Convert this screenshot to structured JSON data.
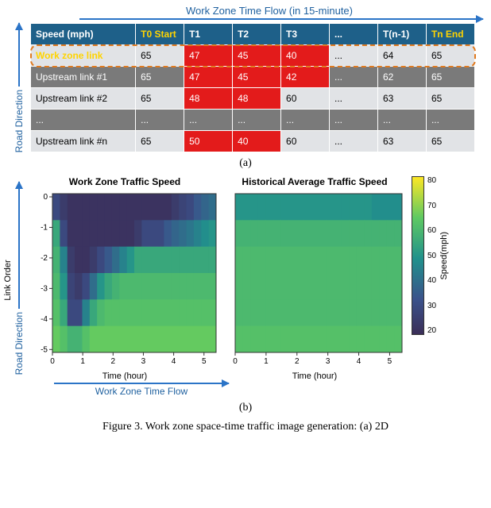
{
  "top_arrow_label": "Work Zone Time Flow (in 15-minute)",
  "road_direction_label": "Road Direction",
  "table": {
    "header": [
      "Speed (mph)",
      "T0 Start",
      "T1",
      "T2",
      "T3",
      "...",
      "T(n-1)",
      "Tn End"
    ],
    "rows": [
      {
        "label": "Work zone link",
        "cells": [
          "65",
          "47",
          "45",
          "40",
          "...",
          "64",
          "65"
        ],
        "red": [
          1,
          2,
          3
        ],
        "highlight_row": true
      },
      {
        "label": "Upstream link #1",
        "cells": [
          "65",
          "47",
          "45",
          "42",
          "...",
          "62",
          "65"
        ],
        "red": [
          1,
          2,
          3
        ]
      },
      {
        "label": "Upstream link #2",
        "cells": [
          "65",
          "48",
          "48",
          "60",
          "...",
          "63",
          "65"
        ],
        "red": [
          1,
          2
        ]
      },
      {
        "label": "...",
        "cells": [
          "...",
          "...",
          "...",
          "...",
          "...",
          "...",
          "..."
        ],
        "red": []
      },
      {
        "label": "Upstream link #n",
        "cells": [
          "65",
          "50",
          "40",
          "60",
          "...",
          "63",
          "65"
        ],
        "red": [
          1,
          2
        ]
      }
    ]
  },
  "sub_a": "(a)",
  "sub_b": "(b)",
  "heatmap": {
    "left_title": "Work Zone Traffic Speed",
    "right_title": "Historical Average Traffic Speed",
    "y_label": "Link Order",
    "x_label": "Time (hour)",
    "colorbar_label": "Speed(mph)",
    "colorbar_ticks": [
      "80",
      "70",
      "60",
      "50",
      "40",
      "30",
      "20"
    ],
    "x_ticks": [
      "0",
      "1",
      "2",
      "3",
      "4",
      "5"
    ],
    "y_ticks": [
      "0",
      "-1",
      "-2",
      "-3",
      "-4",
      "-5"
    ]
  },
  "bottom_arrow_label": "Work Zone Time Flow",
  "caption": "Figure 3. Work zone space-time traffic image generation: (a) 2D",
  "chart_data": [
    {
      "type": "heatmap",
      "title": "Work Zone Traffic Speed",
      "xlabel": "Time (hour)",
      "ylabel": "Link Order",
      "x_ticks": [
        0,
        1,
        2,
        3,
        4,
        5
      ],
      "y_ticks": [
        0,
        -1,
        -2,
        -3,
        -4,
        -5
      ],
      "colorbar_label": "Speed (mph)",
      "colorbar_range": [
        20,
        80
      ],
      "grid_rows": 6,
      "grid_cols": 22,
      "values_by_row": [
        [
          30,
          25,
          22,
          22,
          22,
          22,
          22,
          22,
          22,
          22,
          22,
          22,
          22,
          22,
          22,
          22,
          25,
          28,
          30,
          35,
          38,
          40
        ],
        [
          55,
          30,
          22,
          22,
          22,
          22,
          22,
          22,
          22,
          22,
          22,
          25,
          30,
          30,
          30,
          35,
          38,
          40,
          42,
          45,
          48,
          50
        ],
        [
          58,
          45,
          25,
          22,
          22,
          25,
          30,
          35,
          40,
          45,
          50,
          55,
          55,
          55,
          55,
          55,
          55,
          55,
          55,
          55,
          55,
          55
        ],
        [
          60,
          50,
          28,
          25,
          30,
          40,
          50,
          55,
          58,
          60,
          60,
          60,
          60,
          60,
          60,
          60,
          60,
          60,
          60,
          60,
          60,
          60
        ],
        [
          62,
          55,
          30,
          30,
          45,
          55,
          60,
          62,
          62,
          62,
          62,
          62,
          62,
          62,
          62,
          62,
          62,
          62,
          62,
          62,
          62,
          62
        ],
        [
          65,
          62,
          58,
          58,
          62,
          65,
          65,
          65,
          65,
          65,
          65,
          65,
          65,
          65,
          65,
          65,
          65,
          65,
          65,
          65,
          65,
          65
        ]
      ]
    },
    {
      "type": "heatmap",
      "title": "Historical Average Traffic Speed",
      "xlabel": "Time (hour)",
      "ylabel": "Link Order",
      "x_ticks": [
        0,
        1,
        2,
        3,
        4,
        5
      ],
      "y_ticks": [
        0,
        -1,
        -2,
        -3,
        -4,
        -5
      ],
      "colorbar_label": "Speed (mph)",
      "colorbar_range": [
        20,
        80
      ],
      "grid_rows": 6,
      "grid_cols": 22,
      "values_by_row": [
        [
          50,
          50,
          50,
          50,
          50,
          50,
          50,
          50,
          50,
          50,
          50,
          50,
          50,
          50,
          50,
          50,
          50,
          50,
          48,
          48,
          48,
          48
        ],
        [
          58,
          58,
          58,
          58,
          58,
          58,
          58,
          58,
          58,
          58,
          58,
          58,
          58,
          58,
          58,
          58,
          58,
          58,
          58,
          58,
          58,
          58
        ],
        [
          60,
          60,
          60,
          60,
          60,
          60,
          60,
          60,
          60,
          60,
          60,
          60,
          60,
          60,
          60,
          60,
          60,
          60,
          60,
          60,
          60,
          60
        ],
        [
          60,
          60,
          60,
          60,
          60,
          60,
          60,
          60,
          60,
          60,
          60,
          60,
          60,
          60,
          60,
          60,
          60,
          60,
          60,
          60,
          60,
          60
        ],
        [
          60,
          60,
          60,
          60,
          60,
          60,
          60,
          60,
          60,
          60,
          60,
          60,
          60,
          60,
          60,
          60,
          60,
          60,
          60,
          60,
          60,
          60
        ],
        [
          62,
          62,
          62,
          62,
          62,
          62,
          62,
          62,
          62,
          62,
          62,
          62,
          62,
          62,
          62,
          62,
          62,
          62,
          62,
          62,
          62,
          62
        ]
      ]
    }
  ]
}
